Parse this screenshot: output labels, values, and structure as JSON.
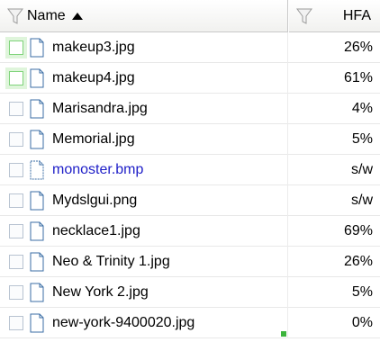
{
  "header": {
    "name_label": "Name",
    "hfa_label": "HFA"
  },
  "colors": {
    "highlight_checkbox": "#7fd37a",
    "blue_file": "#2020c8"
  },
  "rows": [
    {
      "name": "makeup3.jpg",
      "hfa": "26%"
    },
    {
      "name": "makeup4.jpg",
      "hfa": "61%"
    },
    {
      "name": "Marisandra.jpg",
      "hfa": "4%"
    },
    {
      "name": "Memorial.jpg",
      "hfa": "5%"
    },
    {
      "name": "monoster.bmp",
      "hfa": "s/w"
    },
    {
      "name": "Mydslgui.png",
      "hfa": "s/w"
    },
    {
      "name": "necklace1.jpg",
      "hfa": "69%"
    },
    {
      "name": "Neo & Trinity 1.jpg",
      "hfa": "26%"
    },
    {
      "name": "New York 2.jpg",
      "hfa": "5%"
    },
    {
      "name": "new-york-9400020.jpg",
      "hfa": "0%"
    }
  ]
}
